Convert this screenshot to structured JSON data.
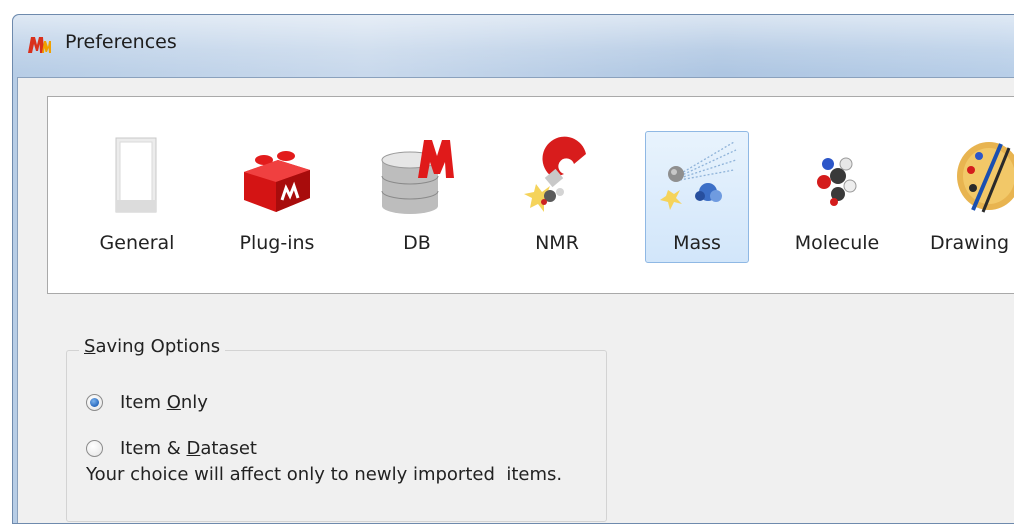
{
  "window": {
    "title": "Preferences",
    "icon": "mnova-logo-icon"
  },
  "toolbar": {
    "items": [
      {
        "label": "General",
        "icon": "general-blank-page-icon",
        "selected": false
      },
      {
        "label": "Plug-ins",
        "icon": "plugin-brick-icon",
        "selected": false
      },
      {
        "label": "DB",
        "icon": "database-icon",
        "selected": false
      },
      {
        "label": "NMR",
        "icon": "nmr-magnet-icon",
        "selected": false
      },
      {
        "label": "Mass",
        "icon": "mass-spectrum-icon",
        "selected": true
      },
      {
        "label": "Molecule",
        "icon": "molecule-icon",
        "selected": false
      },
      {
        "label": "Drawing",
        "icon": "drawing-palette-icon",
        "selected": false
      }
    ]
  },
  "saving_options": {
    "title_prefix": "",
    "title_accel": "S",
    "title_rest": "aving Options",
    "options": [
      {
        "pre": "Item ",
        "accel": "O",
        "post": "nly",
        "checked": true
      },
      {
        "pre": "Item & ",
        "accel": "D",
        "post": "ataset",
        "checked": false
      }
    ],
    "hint": "Your choice will affect only to newly imported  items."
  },
  "colors": {
    "selection_fill": "#d2e6fa",
    "selection_border": "#8fb8e4",
    "radio_dot": "#1e5fb6"
  }
}
